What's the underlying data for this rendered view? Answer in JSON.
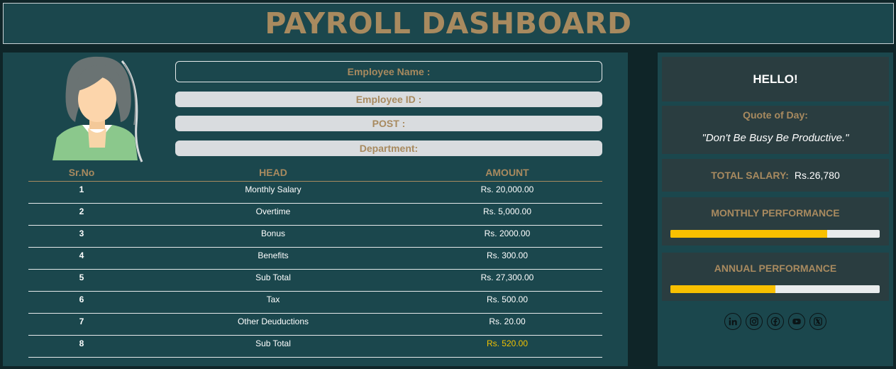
{
  "header": {
    "title": "PAYROLL DASHBOARD"
  },
  "employee": {
    "name_label": "Employee Name :",
    "id_label": "Employee ID :",
    "post_label": "POST :",
    "department_label": "Department:"
  },
  "table": {
    "columns": {
      "sr": "Sr.No",
      "head": "HEAD",
      "amount": "AMOUNT"
    },
    "rows": [
      {
        "sr": "1",
        "head": "Monthly Salary",
        "amount": "Rs. 20,000.00"
      },
      {
        "sr": "2",
        "head": "Overtime",
        "amount": "Rs. 5,000.00"
      },
      {
        "sr": "3",
        "head": "Bonus",
        "amount": "Rs. 2000.00"
      },
      {
        "sr": "4",
        "head": "Benefits",
        "amount": "Rs. 300.00"
      },
      {
        "sr": "5",
        "head": "Sub Total",
        "amount": "Rs. 27,300.00"
      },
      {
        "sr": "6",
        "head": "Tax",
        "amount": "Rs. 500.00"
      },
      {
        "sr": "7",
        "head": "Other Deuductions",
        "amount": "Rs. 20.00"
      },
      {
        "sr": "8",
        "head": "Sub Total",
        "amount": "Rs. 520.00"
      }
    ]
  },
  "sidebar": {
    "greeting": "HELLO!",
    "quote_title": "Quote of Day:",
    "quote_text": "\"Don't Be Busy Be Productive.\"",
    "salary_label": "TOTAL SALARY:",
    "salary_value": "Rs.26,780",
    "monthly_title": "MONTHLY PERFORMANCE",
    "monthly_level": 0.75,
    "annual_title": "ANNUAL PERFORMANCE",
    "annual_level": 0.5,
    "socials": [
      "linkedin-icon",
      "instagram-icon",
      "facebook-icon",
      "youtube-icon",
      "x-icon"
    ]
  },
  "colors": {
    "accent": "#a88a5f",
    "panel": "#1b474d",
    "card": "#2a3d40",
    "bar": "#f9c000",
    "highlight_amount": "#f2c200"
  }
}
